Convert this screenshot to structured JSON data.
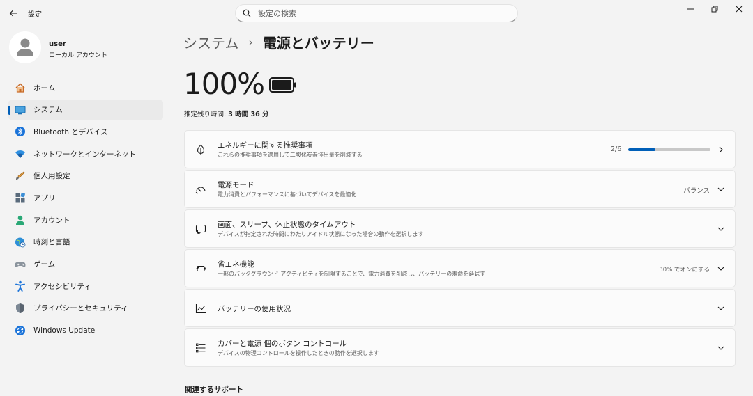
{
  "window": {
    "app_title": "設定",
    "search_placeholder": "設定の検索"
  },
  "user": {
    "name": "user",
    "account_type": "ローカル アカウント"
  },
  "sidebar": {
    "items": [
      {
        "label": "ホーム",
        "icon": "home-icon",
        "active": false
      },
      {
        "label": "システム",
        "icon": "system-icon",
        "active": true
      },
      {
        "label": "Bluetooth とデバイス",
        "icon": "bluetooth-icon",
        "active": false
      },
      {
        "label": "ネットワークとインターネット",
        "icon": "wifi-icon",
        "active": false
      },
      {
        "label": "個人用設定",
        "icon": "brush-icon",
        "active": false
      },
      {
        "label": "アプリ",
        "icon": "apps-icon",
        "active": false
      },
      {
        "label": "アカウント",
        "icon": "account-icon",
        "active": false
      },
      {
        "label": "時刻と言語",
        "icon": "globe-clock-icon",
        "active": false
      },
      {
        "label": "ゲーム",
        "icon": "gamepad-icon",
        "active": false
      },
      {
        "label": "アクセシビリティ",
        "icon": "accessibility-icon",
        "active": false
      },
      {
        "label": "プライバシーとセキュリティ",
        "icon": "shield-icon",
        "active": false
      },
      {
        "label": "Windows Update",
        "icon": "update-icon",
        "active": false
      }
    ]
  },
  "breadcrumb": {
    "parent": "システム",
    "separator": "›",
    "current": "電源とバッテリー"
  },
  "battery": {
    "percent_text": "100%",
    "estimate_label": "推定残り時間: ",
    "estimate_value": "3 時間 36 分"
  },
  "cards": {
    "energy": {
      "title": "エネルギーに関する推奨事項",
      "subtitle": "これらの推奨事項を適用して二酸化炭素排出量を削減する",
      "progress_text": "2/6",
      "progress_fraction": 0.333
    },
    "power_mode": {
      "title": "電源モード",
      "subtitle": "電力消費とパフォーマンスに基づいてデバイスを最適化",
      "value": "バランス"
    },
    "screen_sleep": {
      "title": "画面、スリープ、休止状態のタイムアウト",
      "subtitle": "デバイスが指定された時間にわたりアイドル状態になった場合の動作を選択します"
    },
    "energy_saver": {
      "title": "省エネ機能",
      "subtitle": "一部のバックグラウンド アクティビティを制限することで、電力消費を削減し、バッテリーの寿命を延ばす",
      "value": "30% でオンにする"
    },
    "battery_usage": {
      "title": "バッテリーの使用状況"
    },
    "lid_buttons": {
      "title": "カバーと電源 個のボタン コントロール",
      "subtitle": "デバイスの物理コントロールを操作したときの動作を選択します"
    }
  },
  "related": {
    "heading": "関連するサポート"
  },
  "colors": {
    "accent": "#005fb8",
    "background": "#f3f3f3",
    "card": "#fbfbfb"
  }
}
